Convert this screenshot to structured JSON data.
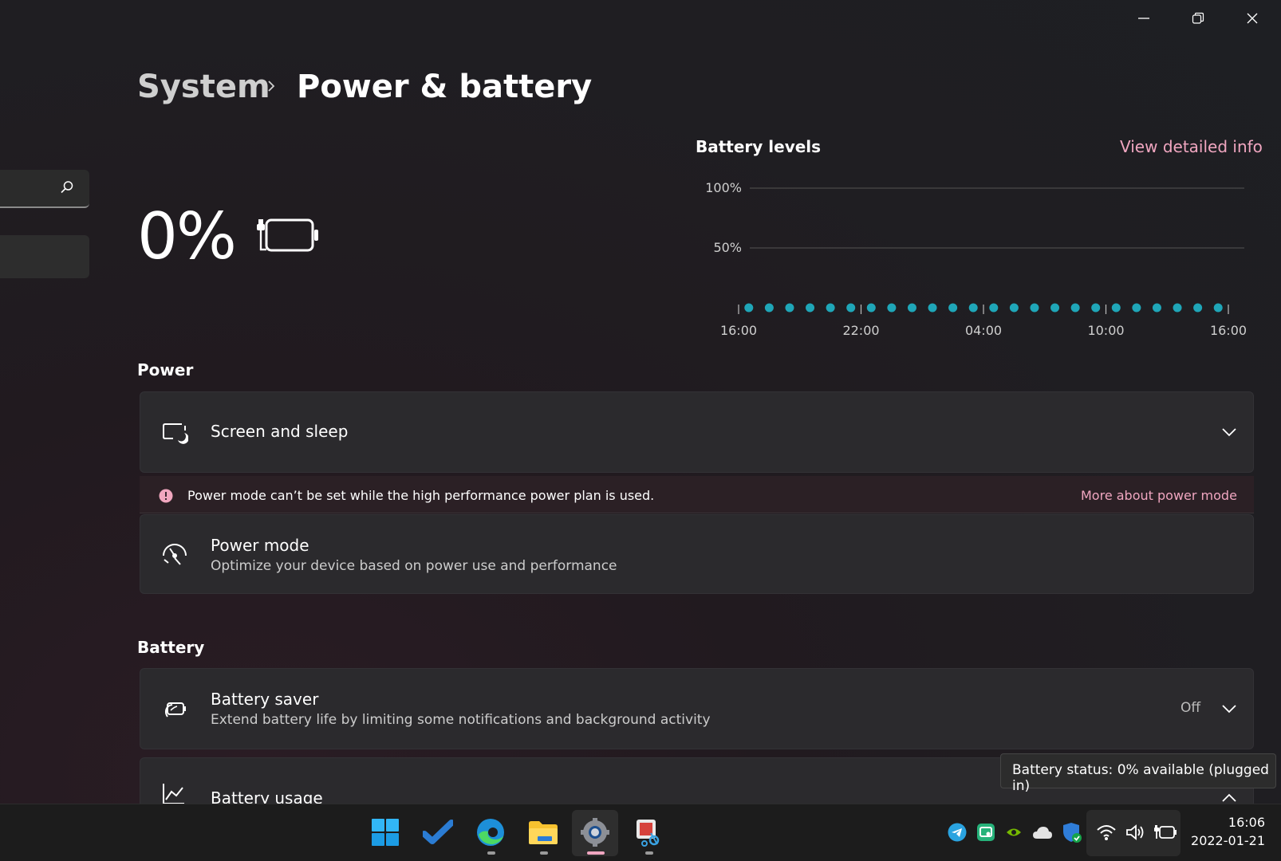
{
  "window": {
    "controls": [
      "minimize-icon",
      "restore-icon",
      "close-icon"
    ]
  },
  "breadcrumb": {
    "parent": "System",
    "separator_icon": "chevron-right-icon",
    "current": "Power & battery"
  },
  "battery_summary": {
    "percent_text": "0%",
    "icon": "battery-plugged-icon"
  },
  "battery_levels": {
    "title": "Battery levels",
    "link": "View detailed info"
  },
  "chart_data": {
    "type": "scatter",
    "title": "Battery levels",
    "y_ticks": [
      "100%",
      "50%"
    ],
    "ylim": [
      0,
      100
    ],
    "x_ticks": [
      "16:00",
      "22:00",
      "04:00",
      "10:00",
      "16:00"
    ],
    "points": [
      {
        "x": "16:30",
        "y": 0
      },
      {
        "x": "17:30",
        "y": 0
      },
      {
        "x": "18:30",
        "y": 0
      },
      {
        "x": "19:30",
        "y": 0
      },
      {
        "x": "20:30",
        "y": 0
      },
      {
        "x": "21:30",
        "y": 0
      },
      {
        "x": "22:30",
        "y": 0
      },
      {
        "x": "23:30",
        "y": 0
      },
      {
        "x": "00:30",
        "y": 0
      },
      {
        "x": "01:30",
        "y": 0
      },
      {
        "x": "02:30",
        "y": 0
      },
      {
        "x": "03:30",
        "y": 0
      },
      {
        "x": "04:30",
        "y": 0
      },
      {
        "x": "05:30",
        "y": 0
      },
      {
        "x": "06:30",
        "y": 0
      },
      {
        "x": "07:30",
        "y": 0
      },
      {
        "x": "08:30",
        "y": 0
      },
      {
        "x": "09:30",
        "y": 0
      },
      {
        "x": "10:30",
        "y": 0
      },
      {
        "x": "11:30",
        "y": 0
      },
      {
        "x": "12:30",
        "y": 0
      },
      {
        "x": "13:30",
        "y": 0
      },
      {
        "x": "14:30",
        "y": 0
      },
      {
        "x": "15:30",
        "y": 0
      }
    ],
    "grid": true,
    "color": "#1fa6b8"
  },
  "power": {
    "header": "Power",
    "screen_sleep": {
      "label": "Screen and sleep",
      "icon": "screen-sleep-icon",
      "chevron": "chevron-down-icon"
    },
    "info_bar": {
      "icon": "info-icon",
      "text": "Power mode can’t be set while the high performance power plan is used.",
      "link": "More about power mode"
    },
    "power_mode": {
      "label": "Power mode",
      "description": "Optimize your device based on power use and performance",
      "icon": "speedometer-icon"
    }
  },
  "battery": {
    "header": "Battery",
    "saver": {
      "label": "Battery saver",
      "description": "Extend battery life by limiting some notifications and background activity",
      "state": "Off",
      "icon": "battery-saver-icon",
      "chevron": "chevron-down-icon"
    },
    "usage": {
      "label": "Battery usage",
      "icon": "chart-line-icon",
      "chevron": "chevron-up-icon"
    }
  },
  "tooltip": {
    "text": "Battery status: 0% available (plugged in)"
  },
  "taskbar": {
    "apps": [
      "start-icon",
      "todo-icon",
      "edge-icon",
      "file-explorer-icon",
      "settings-icon",
      "snipping-tool-icon"
    ],
    "tray": [
      "telegram-icon",
      "app-tray-icon",
      "nvidia-icon",
      "onedrive-icon",
      "security-icon",
      "wifi-icon",
      "volume-icon",
      "battery-plugged-icon"
    ],
    "time": "16:06",
    "date": "2022-01-21",
    "accent": "#f0a6c0"
  }
}
